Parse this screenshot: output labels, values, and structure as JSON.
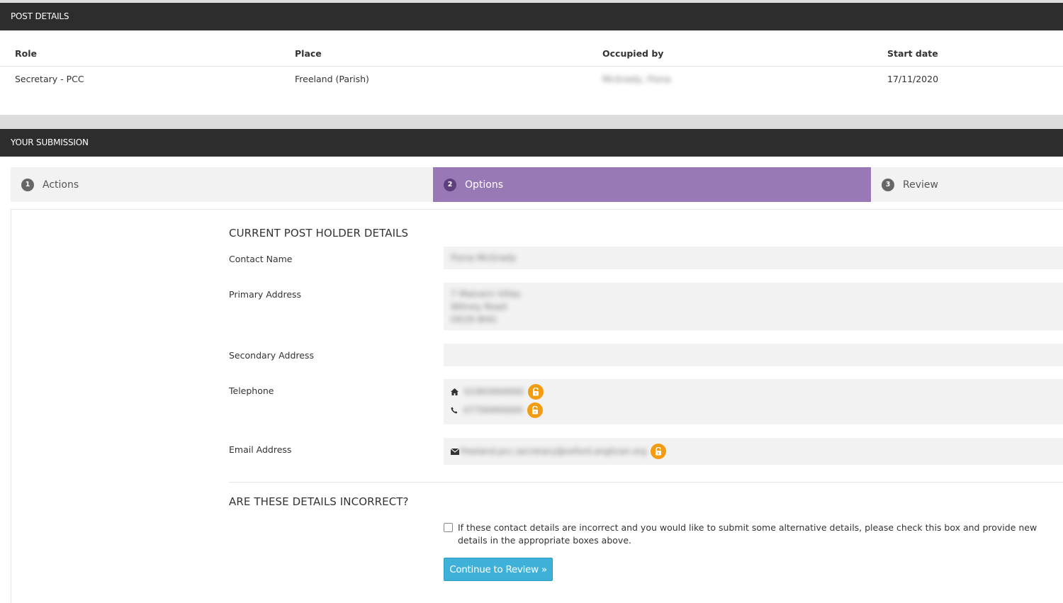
{
  "post_details": {
    "header": "POST DETAILS",
    "columns": [
      "Role",
      "Place",
      "Occupied by",
      "Start date"
    ],
    "row": {
      "role": "Secretary - PCC",
      "place": "Freeland (Parish)",
      "occupied_by": "McGrady, Fiona",
      "start_date": "17/11/2020"
    }
  },
  "submission": {
    "header": "YOUR SUBMISSION",
    "steps": [
      {
        "num": "1",
        "label": "Actions"
      },
      {
        "num": "2",
        "label": "Options"
      },
      {
        "num": "3",
        "label": "Review"
      }
    ],
    "active_step": 2,
    "active_color": "#9879b6"
  },
  "holder": {
    "title": "CURRENT POST HOLDER DETAILS",
    "contact_name_label": "Contact Name",
    "contact_name": "Fiona McGrady",
    "primary_address_label": "Primary Address",
    "primary_address_lines": [
      "7 Malvern Villas",
      "Witney Road",
      "OX29 8HG"
    ],
    "secondary_address_label": "Secondary Address",
    "secondary_address": "",
    "telephone_label": "Telephone",
    "phone_home": "01993000000",
    "phone_mobile": "07700900000",
    "email_label": "Email Address",
    "email": "freeland.pcc.secretary@oxford.anglican.org",
    "lock_color": "#f39c12"
  },
  "incorrect": {
    "title": "ARE THESE DETAILS INCORRECT?",
    "checkbox_text": "If these contact details are incorrect and you would like to submit some alternative details, please check this box and provide new details in the appropriate boxes above.",
    "checked": false,
    "button_label": "Continue to Review »",
    "button_color": "#3fb1d8"
  }
}
